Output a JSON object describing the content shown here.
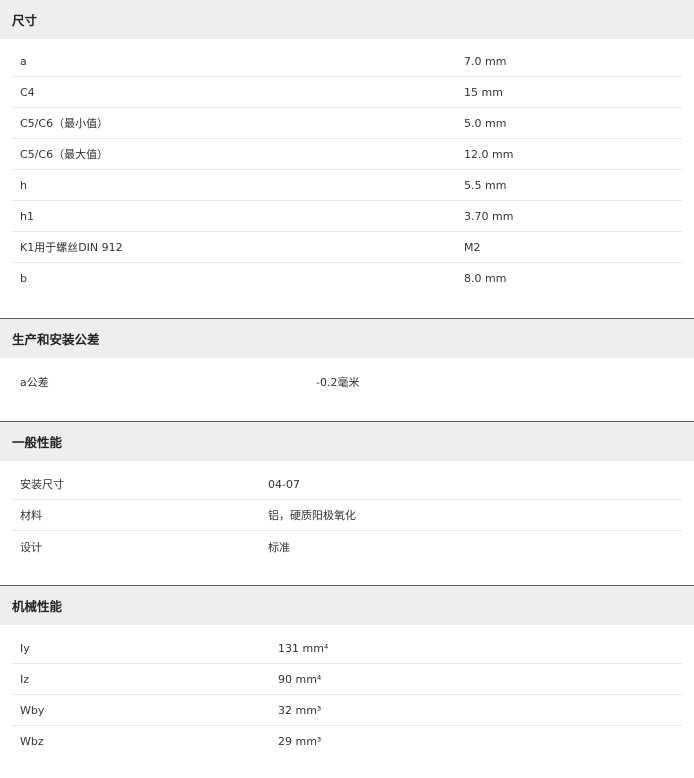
{
  "sections": [
    {
      "title": "尺寸",
      "rows": [
        {
          "label": "a",
          "value": "7.0 mm"
        },
        {
          "label": "C4",
          "value": "15 mm"
        },
        {
          "label": "C5/C6（最小值）",
          "value": "5.0 mm"
        },
        {
          "label": "C5/C6（最大值）",
          "value": "12.0 mm"
        },
        {
          "label": "h",
          "value": "5.5 mm"
        },
        {
          "label": "h1",
          "value": "3.70 mm"
        },
        {
          "label": "K1用于螺丝DIN 912",
          "value": "M2"
        },
        {
          "label": "b",
          "value": "8.0 mm"
        }
      ]
    },
    {
      "title": "生产和安装公差",
      "rows": [
        {
          "label": "a公差",
          "value": "-0.2毫米"
        }
      ]
    },
    {
      "title": "一般性能",
      "rows": [
        {
          "label": "安装尺寸",
          "value": "04-07"
        },
        {
          "label": "材料",
          "value": "铝，硬质阳极氧化"
        },
        {
          "label": "设计",
          "value": "标准"
        }
      ]
    },
    {
      "title": "机械性能",
      "rows": [
        {
          "label": "Iy",
          "value": "131 mm⁴"
        },
        {
          "label": "Iz",
          "value": "90 mm⁴"
        },
        {
          "label": "Wby",
          "value": "32 mm³"
        },
        {
          "label": "Wbz",
          "value": "29 mm³"
        }
      ]
    }
  ]
}
